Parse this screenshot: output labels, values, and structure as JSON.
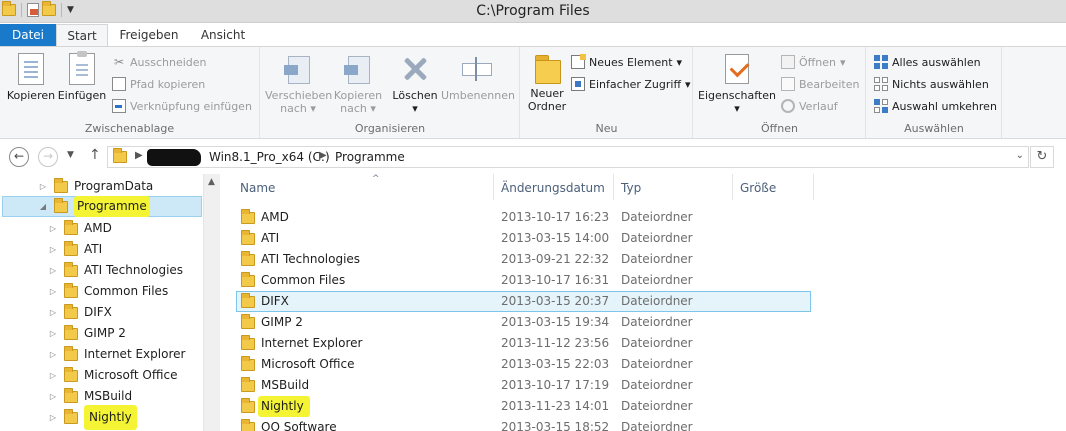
{
  "window": {
    "title": "C:\\Program Files"
  },
  "ribbon_tabs": {
    "file": "Datei",
    "start": "Start",
    "share": "Freigeben",
    "view": "Ansicht"
  },
  "ribbon": {
    "clipboard": {
      "label": "Zwischenablage",
      "copy": "Kopieren",
      "paste": "Einfügen",
      "cut": "Ausschneiden",
      "copy_path": "Pfad kopieren",
      "paste_shortcut": "Verknüpfung einfügen"
    },
    "organize": {
      "label": "Organisieren",
      "move_to": "Verschieben",
      "move_to_2": "nach",
      "copy_to": "Kopieren",
      "copy_to_2": "nach",
      "delete": "Löschen",
      "rename": "Umbenennen"
    },
    "new": {
      "label": "Neu",
      "new_folder": "Neuer",
      "new_folder_2": "Ordner",
      "new_item": "Neues Element",
      "easy_access": "Einfacher Zugriff"
    },
    "open": {
      "label": "Öffnen",
      "properties": "Eigenschaften",
      "open": "Öffnen",
      "edit": "Bearbeiten",
      "history": "Verlauf"
    },
    "select": {
      "label": "Auswählen",
      "select_all": "Alles auswählen",
      "select_none": "Nichts auswählen",
      "invert": "Auswahl umkehren"
    }
  },
  "address": {
    "crumb_drive": "Win8.1_Pro_x64 (C:)",
    "crumb_folder": "Programme"
  },
  "nav_tree": {
    "items": [
      {
        "label": "ProgramData"
      },
      {
        "label": "Programme"
      },
      {
        "label": "AMD"
      },
      {
        "label": "ATI"
      },
      {
        "label": "ATI Technologies"
      },
      {
        "label": "Common Files"
      },
      {
        "label": "DIFX"
      },
      {
        "label": "GIMP 2"
      },
      {
        "label": "Internet Explorer"
      },
      {
        "label": "Microsoft Office"
      },
      {
        "label": "MSBuild"
      },
      {
        "label": "Nightly"
      }
    ]
  },
  "list": {
    "columns": {
      "name": "Name",
      "date": "Änderungsdatum",
      "type": "Typ",
      "size": "Größe"
    },
    "rows": [
      {
        "name": "AMD",
        "date": "2013-10-17 16:23",
        "type": "Dateiordner"
      },
      {
        "name": "ATI",
        "date": "2013-03-15 14:00",
        "type": "Dateiordner"
      },
      {
        "name": "ATI Technologies",
        "date": "2013-09-21 22:32",
        "type": "Dateiordner"
      },
      {
        "name": "Common Files",
        "date": "2013-10-17 16:31",
        "type": "Dateiordner"
      },
      {
        "name": "DIFX",
        "date": "2013-03-15 20:37",
        "type": "Dateiordner"
      },
      {
        "name": "GIMP 2",
        "date": "2013-03-15 19:34",
        "type": "Dateiordner"
      },
      {
        "name": "Internet Explorer",
        "date": "2013-11-12 23:56",
        "type": "Dateiordner"
      },
      {
        "name": "Microsoft Office",
        "date": "2013-03-15 22:03",
        "type": "Dateiordner"
      },
      {
        "name": "MSBuild",
        "date": "2013-10-17 17:19",
        "type": "Dateiordner"
      },
      {
        "name": "Nightly",
        "date": "2013-11-23 14:01",
        "type": "Dateiordner"
      },
      {
        "name": "OO Software",
        "date": "2013-03-15 18:52",
        "type": "Dateiordner"
      }
    ]
  },
  "colors": {
    "file_tab": "#1979ca",
    "highlight": "#f4f434",
    "selection": "#cde8f7"
  }
}
